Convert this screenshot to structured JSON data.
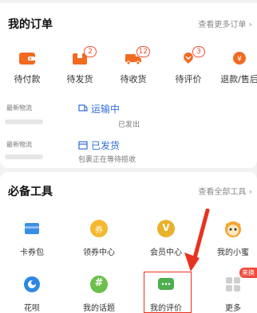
{
  "orders": {
    "title": "我的订单",
    "more": "查看更多订单",
    "items": [
      {
        "label": "待付款",
        "badge": ""
      },
      {
        "label": "待发货",
        "badge": "2"
      },
      {
        "label": "待收货",
        "badge": "12"
      },
      {
        "label": "待评价",
        "badge": "3"
      },
      {
        "label": "退款/售后",
        "badge": ""
      }
    ],
    "logistics": [
      {
        "label": "最新物流",
        "status": "运输中",
        "detail": "已发出"
      },
      {
        "label": "最新物流",
        "status": "已发货",
        "detail": "包裹正在等待揽收"
      }
    ]
  },
  "tools": {
    "title": "必备工具",
    "more": "查看全部工具",
    "items": [
      {
        "label": "卡券包"
      },
      {
        "label": "领券中心"
      },
      {
        "label": "会员中心"
      },
      {
        "label": "我的小蜜"
      },
      {
        "label": "花呗"
      },
      {
        "label": "我的话题"
      },
      {
        "label": "我的评价"
      },
      {
        "label": "更多"
      }
    ],
    "new_tag": "来换",
    "coupon_icon_char": "券",
    "topic_icon_char": "#",
    "member_icon_char": "V"
  },
  "colors": {
    "accent_orange": "#f26a21",
    "link_blue": "#2f6ed8",
    "highlight_red": "#e8321f"
  }
}
